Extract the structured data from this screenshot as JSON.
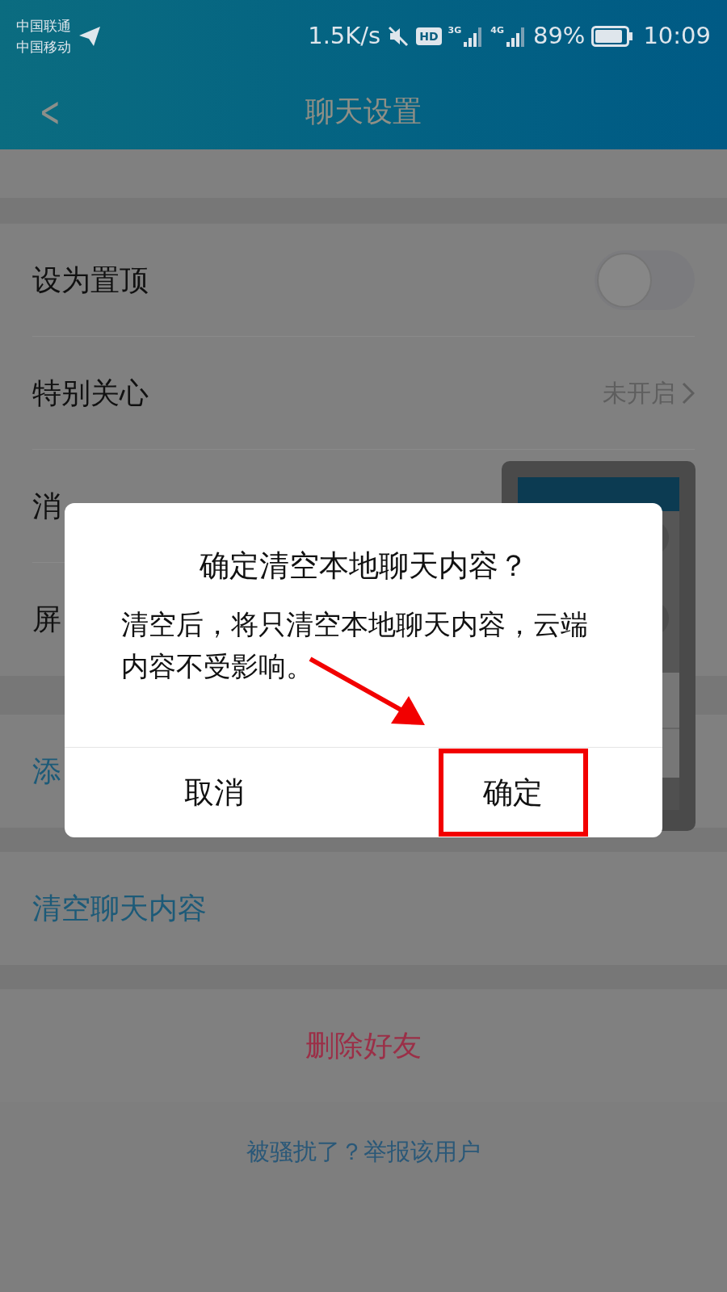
{
  "status_bar": {
    "carriers": [
      "中国联通",
      "中国移动"
    ],
    "speed": "1.5K/s",
    "hd": "HD",
    "networks": [
      "3G",
      "4G"
    ],
    "battery": "89%",
    "time": "10:09"
  },
  "header": {
    "back": "<",
    "title": "聊天设置"
  },
  "sections": [
    {
      "rows": [
        {
          "kind": "toggle",
          "label": "设为置顶",
          "on": false
        },
        {
          "kind": "link",
          "label": "特别关心",
          "value": "未开启"
        },
        {
          "kind": "plain",
          "label": "消"
        },
        {
          "kind": "plain",
          "label": "屏"
        }
      ]
    },
    {
      "rows": [
        {
          "kind": "action",
          "label": "添"
        }
      ]
    },
    {
      "rows": [
        {
          "kind": "action",
          "label": "清空聊天内容"
        }
      ]
    },
    {
      "rows": [
        {
          "kind": "danger",
          "label": "删除好友"
        }
      ]
    }
  ],
  "report_link": "被骚扰了？举报该用户",
  "dialog": {
    "title": "确定清空本地聊天内容？",
    "message": "清空后，将只清空本地聊天内容，云端内容不受影响。",
    "buttons": [
      {
        "label": "取消",
        "highlighted": false
      },
      {
        "label": "确定",
        "highlighted": true
      }
    ]
  }
}
